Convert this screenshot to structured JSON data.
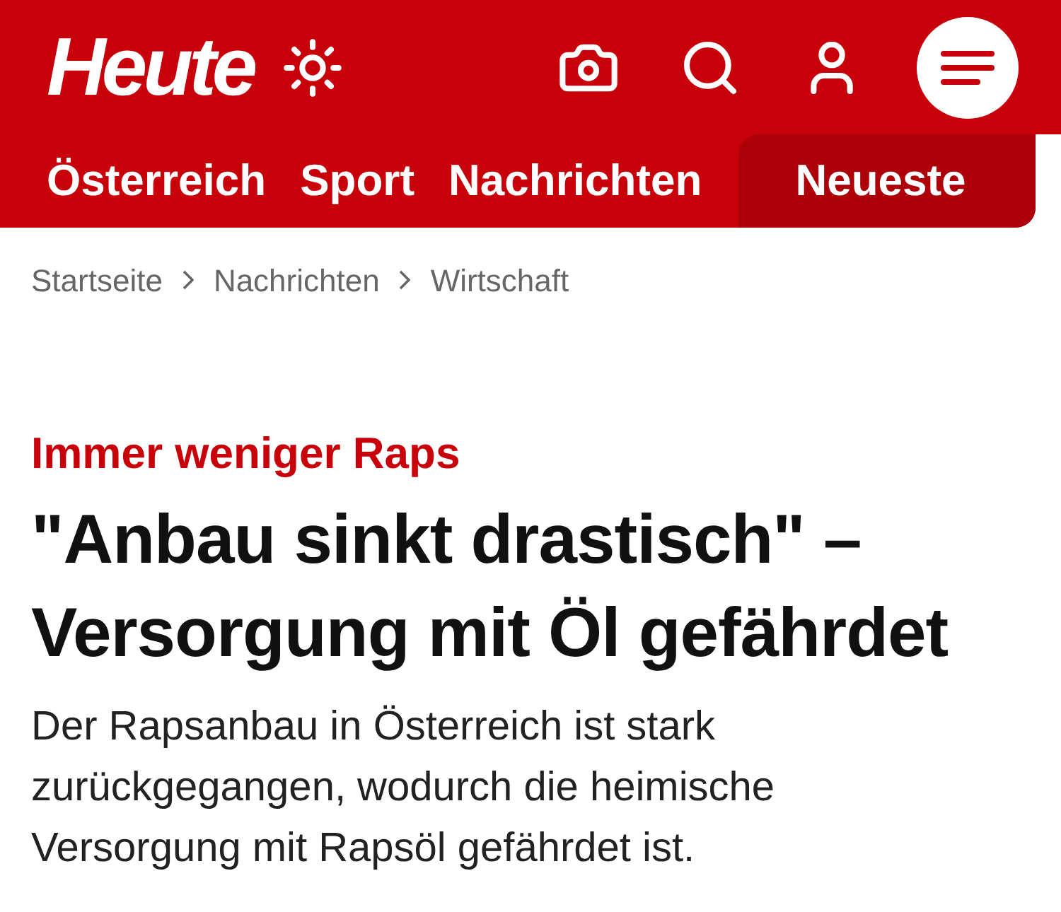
{
  "header": {
    "logo": "Heute"
  },
  "nav": [
    {
      "label": "Österreich",
      "selected": false
    },
    {
      "label": "Sport",
      "selected": false
    },
    {
      "label": "Nachrichten",
      "selected": false
    },
    {
      "label": "Neueste",
      "selected": true
    }
  ],
  "breadcrumb": [
    "Startseite",
    "Nachrichten",
    "Wirtschaft"
  ],
  "article": {
    "kicker": "Immer weniger Raps",
    "headline": "\"Anbau sinkt drastisch\" – Versorgung mit Öl gefährdet",
    "lead": "Der Rapsanbau in Österreich ist stark zurückgegangen, wodurch die heimische Versorgung mit Rapsöl gefährdet ist."
  }
}
